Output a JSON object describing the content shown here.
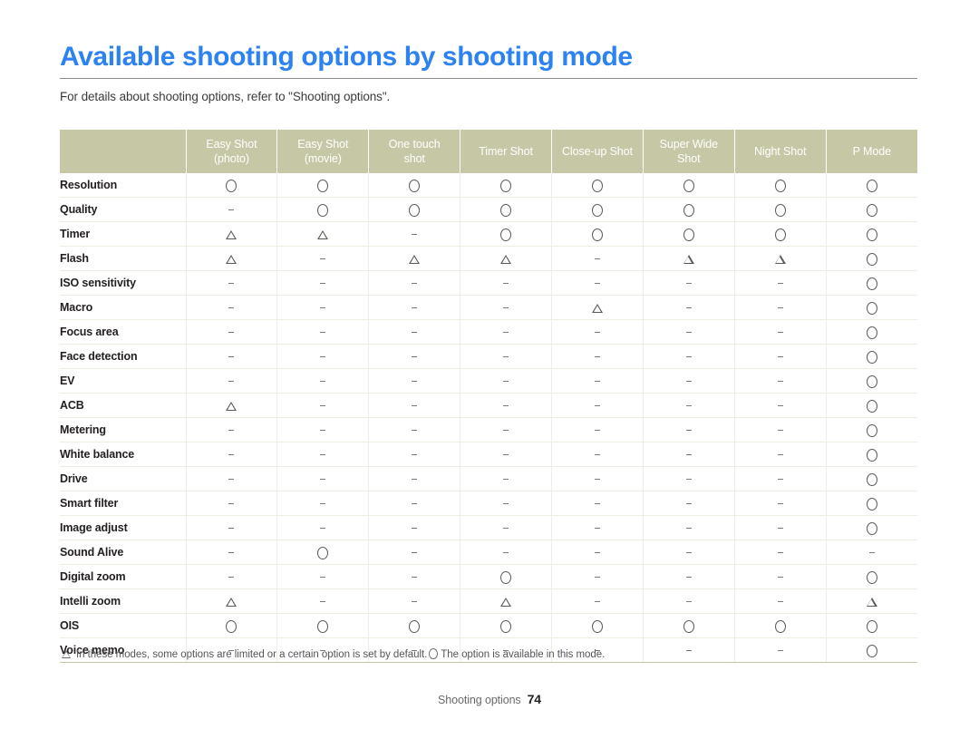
{
  "document": {
    "title": "Available shooting options by shooting mode",
    "subtitle": "For details about shooting options, refer to \"Shooting options\".",
    "footer_label": "Shooting options",
    "page_number": "74"
  },
  "legend": {
    "triangle_icon": "triangle-icon",
    "circle_icon": "circle-icon",
    "triangle_text": "In these modes, some options are limited or a certain option is set by default.",
    "circle_text": "The option is available in this mode."
  },
  "colors": {
    "title_blue": "#2b82f0",
    "header_khaki": "#c6c8a5",
    "grid_line": "#eeeee4",
    "text_dark": "#231f20"
  },
  "table": {
    "corner_label": "",
    "columns": [
      {
        "line1": "Easy Shot",
        "line2": "(photo)"
      },
      {
        "line1": "Easy Shot",
        "line2": "(movie)"
      },
      {
        "line1": "One touch",
        "line2": "shot"
      },
      {
        "line1": "Timer Shot",
        "line2": ""
      },
      {
        "line1": "Close-up Shot",
        "line2": ""
      },
      {
        "line1": "Super Wide",
        "line2": "Shot"
      },
      {
        "line1": "Night Shot",
        "line2": ""
      },
      {
        "line1": "P Mode",
        "line2": ""
      }
    ],
    "rows": [
      {
        "label": "Resolution",
        "values": [
          "circle",
          "circle",
          "circle",
          "circle",
          "circle",
          "circle",
          "circle",
          "circle"
        ]
      },
      {
        "label": "Quality",
        "values": [
          "dash",
          "circle",
          "circle",
          "circle",
          "circle",
          "circle",
          "circle",
          "circle"
        ]
      },
      {
        "label": "Timer",
        "values": [
          "triangle",
          "triangle",
          "dash",
          "circle",
          "circle",
          "circle",
          "circle",
          "circle"
        ]
      },
      {
        "label": "Flash",
        "values": [
          "triangle",
          "dash",
          "triangle",
          "triangle",
          "dash",
          "triangle",
          "triangle",
          "circle"
        ]
      },
      {
        "label": "ISO sensitivity",
        "values": [
          "dash",
          "dash",
          "dash",
          "dash",
          "dash",
          "dash",
          "dash",
          "circle"
        ]
      },
      {
        "label": "Macro",
        "values": [
          "dash",
          "dash",
          "dash",
          "dash",
          "triangle",
          "dash",
          "dash",
          "circle"
        ]
      },
      {
        "label": "Focus area",
        "values": [
          "dash",
          "dash",
          "dash",
          "dash",
          "dash",
          "dash",
          "dash",
          "circle"
        ]
      },
      {
        "label": "Face detection",
        "values": [
          "dash",
          "dash",
          "dash",
          "dash",
          "dash",
          "dash",
          "dash",
          "circle"
        ]
      },
      {
        "label": "EV",
        "values": [
          "dash",
          "dash",
          "dash",
          "dash",
          "dash",
          "dash",
          "dash",
          "circle"
        ]
      },
      {
        "label": "ACB",
        "values": [
          "triangle",
          "dash",
          "dash",
          "dash",
          "dash",
          "dash",
          "dash",
          "circle"
        ]
      },
      {
        "label": "Metering",
        "values": [
          "dash",
          "dash",
          "dash",
          "dash",
          "dash",
          "dash",
          "dash",
          "circle"
        ]
      },
      {
        "label": "White balance",
        "values": [
          "dash",
          "dash",
          "dash",
          "dash",
          "dash",
          "dash",
          "dash",
          "circle"
        ]
      },
      {
        "label": "Drive",
        "values": [
          "dash",
          "dash",
          "dash",
          "dash",
          "dash",
          "dash",
          "dash",
          "circle"
        ]
      },
      {
        "label": "Smart filter",
        "values": [
          "dash",
          "dash",
          "dash",
          "dash",
          "dash",
          "dash",
          "dash",
          "circle"
        ]
      },
      {
        "label": "Image adjust",
        "values": [
          "dash",
          "dash",
          "dash",
          "dash",
          "dash",
          "dash",
          "dash",
          "circle"
        ]
      },
      {
        "label": "Sound Alive",
        "values": [
          "dash",
          "circle",
          "dash",
          "dash",
          "dash",
          "dash",
          "dash",
          "dash"
        ]
      },
      {
        "label": "Digital zoom",
        "values": [
          "dash",
          "dash",
          "dash",
          "circle",
          "dash",
          "dash",
          "dash",
          "circle"
        ]
      },
      {
        "label": "Intelli zoom",
        "values": [
          "triangle",
          "dash",
          "dash",
          "triangle",
          "dash",
          "dash",
          "dash",
          "triangle"
        ]
      },
      {
        "label": "OIS",
        "values": [
          "circle",
          "circle",
          "circle",
          "circle",
          "circle",
          "circle",
          "circle",
          "circle"
        ]
      },
      {
        "label": "Voice memo",
        "values": [
          "dash",
          "dash",
          "dash",
          "dash",
          "dash",
          "dash",
          "dash",
          "circle"
        ]
      }
    ]
  }
}
